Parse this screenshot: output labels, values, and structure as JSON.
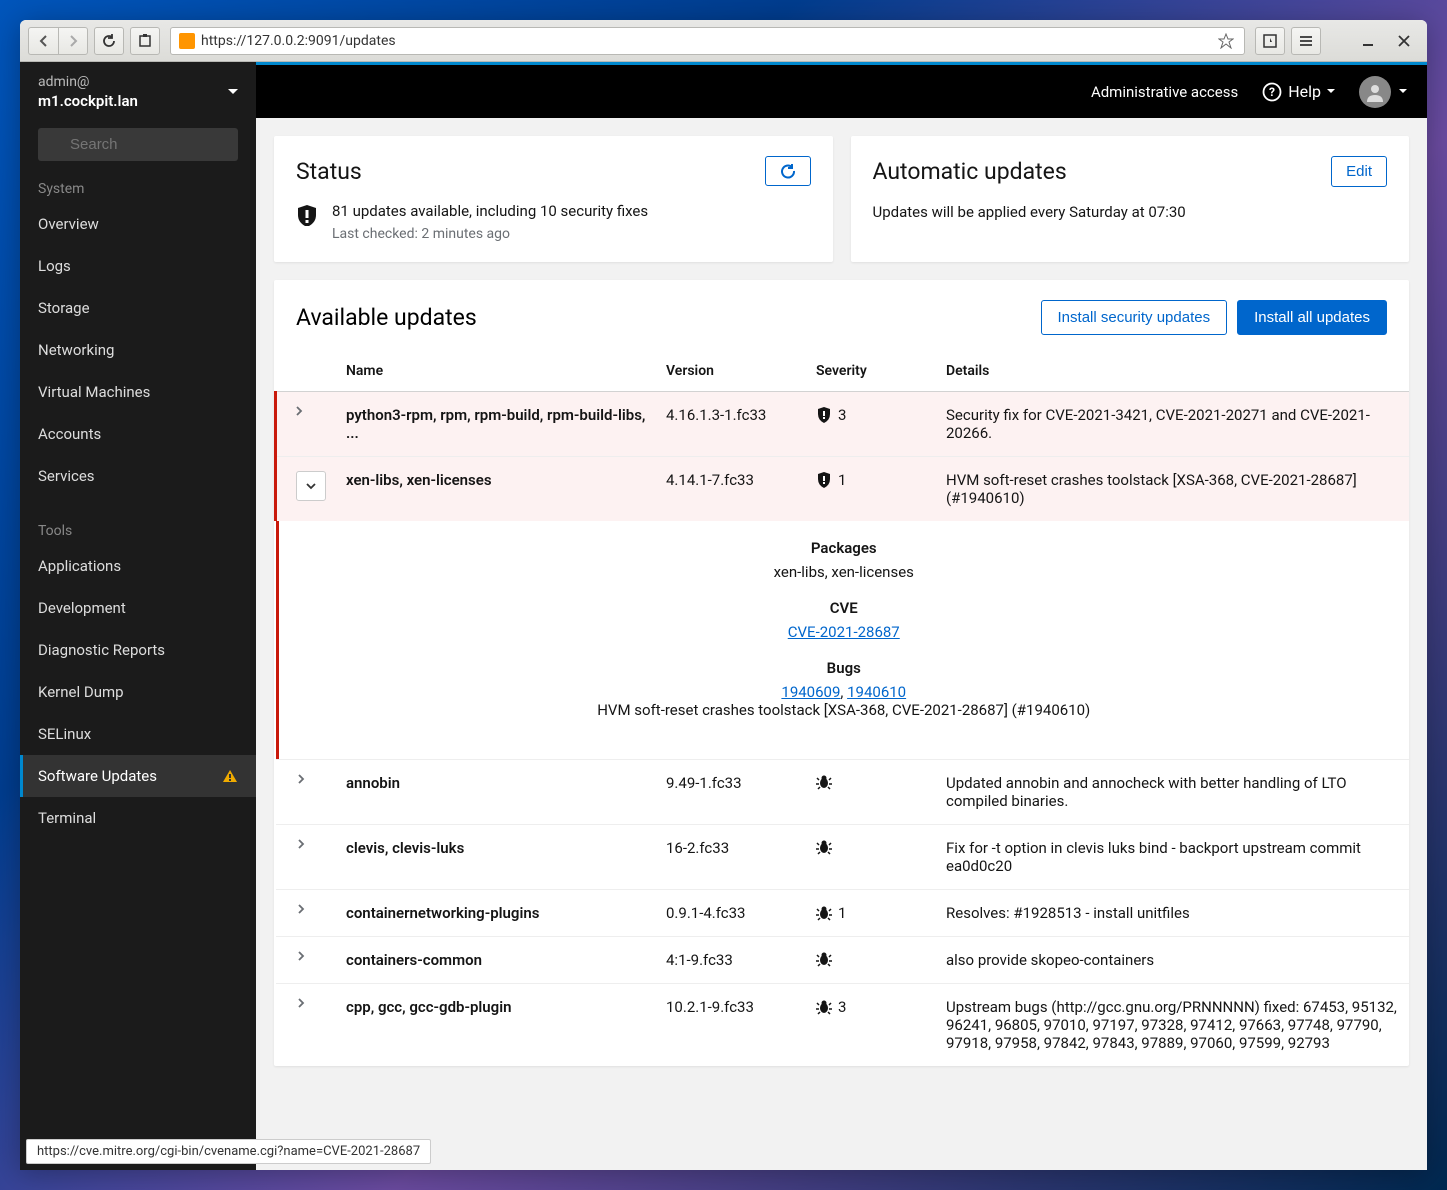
{
  "browser": {
    "url": "https://127.0.0.2:9091/updates",
    "status_link": "https://cve.mitre.org/cgi-bin/cvename.cgi?name=CVE-2021-28687"
  },
  "sidebar": {
    "user": "admin@",
    "host": "m1.cockpit.lan",
    "search_placeholder": "Search",
    "sections": {
      "system": "System",
      "tools": "Tools"
    },
    "system_items": [
      "Overview",
      "Logs",
      "Storage",
      "Networking",
      "Virtual Machines",
      "Accounts",
      "Services"
    ],
    "tools_items": [
      "Applications",
      "Development",
      "Diagnostic Reports",
      "Kernel Dump",
      "SELinux",
      "Software Updates",
      "Terminal"
    ]
  },
  "topbar": {
    "admin_access": "Administrative access",
    "help": "Help"
  },
  "status_card": {
    "title": "Status",
    "main": "81 updates available, including 10 security fixes",
    "sub": "Last checked: 2 minutes ago"
  },
  "auto_card": {
    "title": "Automatic updates",
    "edit": "Edit",
    "text": "Updates will be applied every Saturday at 07:30"
  },
  "updates": {
    "title": "Available updates",
    "install_security": "Install security updates",
    "install_all": "Install all updates",
    "columns": {
      "name": "Name",
      "version": "Version",
      "severity": "Severity",
      "details": "Details"
    },
    "rows": [
      {
        "name": "python3-rpm, rpm, rpm-build, rpm-build-libs, ...",
        "version": "4.16.1.3-1.fc33",
        "severity": "3",
        "sevtype": "security",
        "details": "Security fix for CVE-2021-3421, CVE-2021-20271 and CVE-2021-20266."
      },
      {
        "name": "xen-libs, xen-licenses",
        "version": "4.14.1-7.fc33",
        "severity": "1",
        "sevtype": "security",
        "details": "HVM soft-reset crashes toolstack [XSA-368, CVE-2021-28687] (#1940610)"
      },
      {
        "name": "annobin",
        "version": "9.49-1.fc33",
        "severity": "",
        "sevtype": "bug",
        "details": "Updated annobin and annocheck with better handling of LTO compiled binaries."
      },
      {
        "name": "clevis, clevis-luks",
        "version": "16-2.fc33",
        "severity": "",
        "sevtype": "bug",
        "details": "Fix for -t option in clevis luks bind - backport upstream commit ea0d0c20"
      },
      {
        "name": "containernetworking-plugins",
        "version": "0.9.1-4.fc33",
        "severity": "1",
        "sevtype": "bug",
        "details": "Resolves: #1928513 - install unitfiles"
      },
      {
        "name": "containers-common",
        "version": "4:1-9.fc33",
        "severity": "",
        "sevtype": "bug",
        "details": "also provide skopeo-containers"
      },
      {
        "name": "cpp, gcc, gcc-gdb-plugin",
        "version": "10.2.1-9.fc33",
        "severity": "3",
        "sevtype": "bug",
        "details": "Upstream bugs (http://gcc.gnu.org/PRNNNNN) fixed: 67453, 95132, 96241, 96805, 97010, 97197, 97328, 97412, 97663, 97748, 97790, 97918, 97958, 97842, 97843, 97889, 97060, 97599, 92793"
      }
    ],
    "expanded": {
      "packages_label": "Packages",
      "packages": "xen-libs, xen-licenses",
      "cve_label": "CVE",
      "cve": "CVE-2021-28687",
      "bugs_label": "Bugs",
      "bug1": "1940609",
      "bug_sep": ", ",
      "bug2": "1940610",
      "bug_desc": "HVM soft-reset crashes toolstack [XSA-368, CVE-2021-28687] (#1940610)"
    }
  }
}
